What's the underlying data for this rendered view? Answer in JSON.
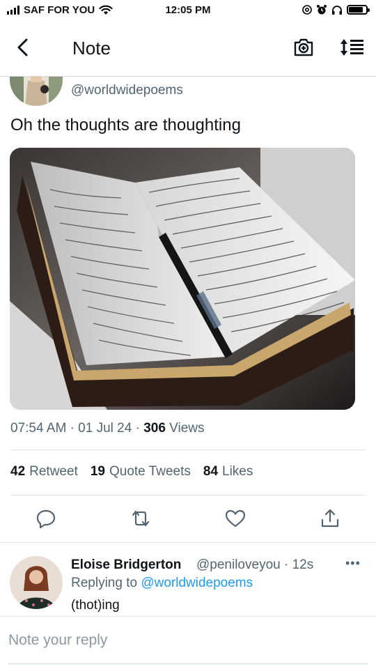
{
  "status_bar": {
    "carrier": "SAF FOR YOU",
    "time": "12:05 PM",
    "battery_level": 0.85
  },
  "header": {
    "title": "Note",
    "back_icon": "chevron-left-icon",
    "camera_icon": "camera-add-icon",
    "sort_icon": "sort-list-icon"
  },
  "tweet": {
    "handle": "@worldwidepoems",
    "text": "Oh the thoughts are thoughting",
    "photo_alt": "open notebook with handwriting and a pen",
    "time": "07:54 AM",
    "date": "01 Jul 24",
    "views_count": "306",
    "views_label": "Views",
    "separator": "·",
    "stats": {
      "retweets_count": "42",
      "retweets_label": "Retweet",
      "quotes_count": "19",
      "quotes_label": "Quote Tweets",
      "likes_count": "84",
      "likes_label": "Likes"
    }
  },
  "reply": {
    "name": "Eloise Bridgerton",
    "handle": "@peniloveyou · 12s",
    "more": "•••",
    "replying_prefix": "Replying to",
    "replying_to": "@worldwidepoems",
    "text": "(thot)ing"
  },
  "compose": {
    "placeholder": "Note your reply"
  },
  "colors": {
    "link": "#1d9bf0",
    "secondary_text": "#536471",
    "divider": "#e1e4e6"
  }
}
